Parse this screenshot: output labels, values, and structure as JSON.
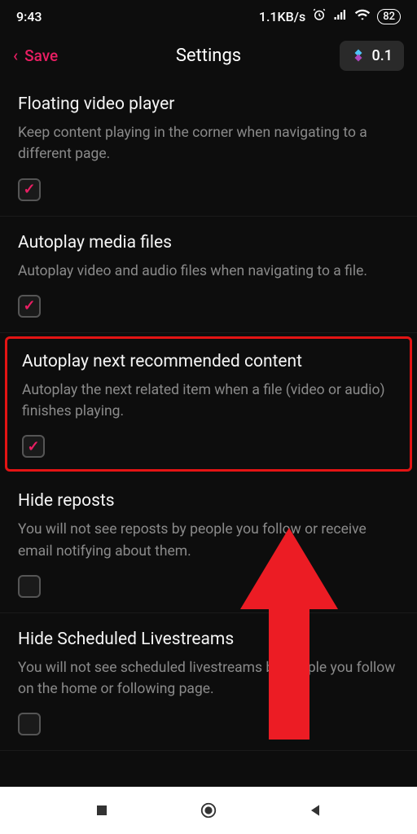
{
  "status_bar": {
    "time": "9:43",
    "network_speed": "1.1KB/s",
    "battery_percent": "82"
  },
  "header": {
    "back_label": "Save",
    "title": "Settings",
    "coin_value": "0.1"
  },
  "settings": [
    {
      "title": "Floating video player",
      "description": "Keep content playing in the corner when navigating to a different page.",
      "checked": true,
      "highlighted": false
    },
    {
      "title": "Autoplay media files",
      "description": "Autoplay video and audio files when navigating to a file.",
      "checked": true,
      "highlighted": false
    },
    {
      "title": "Autoplay next recommended content",
      "description": "Autoplay the next related item when a file (video or audio) finishes playing.",
      "checked": true,
      "highlighted": true
    },
    {
      "title": "Hide reposts",
      "description": "You will not see reposts by people you follow or receive email notifying about them.",
      "checked": false,
      "highlighted": false
    },
    {
      "title": "Hide Scheduled Livestreams",
      "description": "You will not see scheduled livestreams by people you follow on the home or following page.",
      "checked": false,
      "highlighted": false
    }
  ]
}
